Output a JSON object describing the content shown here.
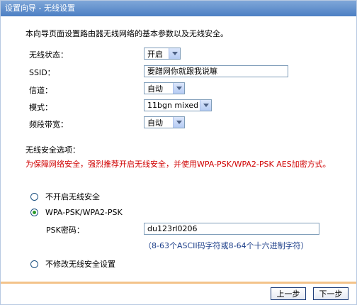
{
  "window": {
    "title": "设置向导 - 无线设置"
  },
  "description": "本向导页面设置路由器无线网络的基本参数以及无线安全。",
  "fields": {
    "wireless_status": {
      "label": "无线状态：",
      "value": "开启"
    },
    "ssid": {
      "label": "SSID：",
      "value": "要蹭网你就跟我说嘛"
    },
    "channel": {
      "label": "信道：",
      "value": "自动"
    },
    "mode": {
      "label": "模式：",
      "value": "11bgn mixed"
    },
    "bandwidth": {
      "label": "频段带宽：",
      "value": "自动"
    }
  },
  "security": {
    "section_title": "无线安全选项：",
    "warning": "为保障网络安全，强烈推荐开启无线安全，并使用WPA-PSK/WPA2-PSK AES加密方式。",
    "options": [
      {
        "label": "不开启无线安全",
        "selected": false
      },
      {
        "label": "WPA-PSK/WPA2-PSK",
        "selected": true
      },
      {
        "label": "不修改无线安全设置",
        "selected": false
      }
    ],
    "psk_label": "PSK密码：",
    "psk_value": "du123rl0206",
    "psk_hint": "（8-63个ASCII码字符或8-64个十六进制字符）"
  },
  "buttons": {
    "prev": "上一步",
    "next": "下一步"
  },
  "colors": {
    "title_bar": "#4c7fc4",
    "warning": "#d00000",
    "hint": "#1d3f8a",
    "divider": "#f3c38a"
  }
}
